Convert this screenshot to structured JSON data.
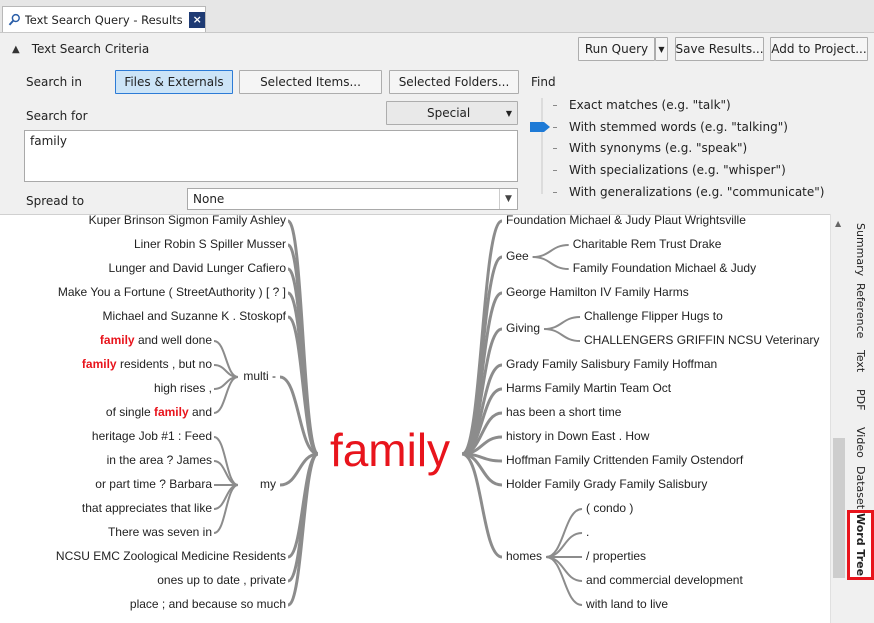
{
  "tab": {
    "title": "Text Search Query - Results Pre",
    "close": "×"
  },
  "criteria": {
    "header": "Text Search Criteria",
    "buttons": {
      "run": "Run Query",
      "save": "Save Results...",
      "add": "Add to Project..."
    },
    "search_in_label": "Search in",
    "search_in_options": [
      "Files & Externals",
      "Selected Items...",
      "Selected Folders..."
    ],
    "search_in_selected": "Files & Externals",
    "search_for_label": "Search for",
    "special_label": "Special",
    "search_value": "family",
    "spread_label": "Spread to",
    "spread_value": "None",
    "find_label": "Find",
    "find_options": [
      "Exact matches (e.g. \"talk\")",
      "With stemmed words (e.g. \"talking\")",
      "With synonyms (e.g. \"speak\")",
      "With specializations (e.g. \"whisper\")",
      "With generalizations (e.g. \"communicate\")"
    ],
    "find_selected_index": 1
  },
  "word_tree": {
    "root": "family",
    "highlight_color": "#e8141c",
    "left": [
      {
        "segments": [
          {
            "t": "Kuper Brinson Sigmon Family Ashley"
          }
        ]
      },
      {
        "segments": [
          {
            "t": "Liner Robin S Spiller Musser"
          }
        ]
      },
      {
        "segments": [
          {
            "t": "Lunger and David Lunger Cafiero"
          }
        ]
      },
      {
        "segments": [
          {
            "t": "Make You a Fortune ( StreetAuthority ) [ ? ]"
          }
        ]
      },
      {
        "segments": [
          {
            "t": "Michael and Suzanne K . Stoskopf"
          }
        ]
      },
      {
        "group": "multi -",
        "children": [
          {
            "segments": [
              {
                "t": "family",
                "hl": true
              },
              {
                "t": " and well done"
              }
            ]
          },
          {
            "segments": [
              {
                "t": "family",
                "hl": true
              },
              {
                "t": " residents , but no"
              }
            ]
          },
          {
            "segments": [
              {
                "t": "high rises ,"
              }
            ]
          },
          {
            "segments": [
              {
                "t": "of single "
              },
              {
                "t": "family",
                "hl": true
              },
              {
                "t": " and"
              }
            ]
          }
        ]
      },
      {
        "group": "my",
        "children": [
          {
            "segments": [
              {
                "t": "heritage Job #1 : Feed"
              }
            ]
          },
          {
            "segments": [
              {
                "t": "in the area ? James"
              }
            ]
          },
          {
            "segments": [
              {
                "t": "or part time ? Barbara"
              }
            ]
          },
          {
            "segments": [
              {
                "t": "that appreciates that like"
              }
            ]
          },
          {
            "segments": [
              {
                "t": "There was seven in"
              }
            ]
          }
        ]
      },
      {
        "segments": [
          {
            "t": "NCSU EMC Zoological Medicine Residents"
          }
        ]
      },
      {
        "segments": [
          {
            "t": "ones up to date , private"
          }
        ]
      },
      {
        "segments": [
          {
            "t": "place ; and because so much"
          }
        ]
      }
    ],
    "right": [
      {
        "segments": [
          {
            "t": "Foundation Michael & Judy Plaut Wrightsville"
          }
        ]
      },
      {
        "group": "Gee",
        "children": [
          {
            "segments": [
              {
                "t": "Charitable Rem Trust Drake"
              }
            ]
          },
          {
            "segments": [
              {
                "t": "Family Foundation Michael & Judy"
              }
            ]
          }
        ]
      },
      {
        "segments": [
          {
            "t": "George Hamilton IV Family Harms"
          }
        ]
      },
      {
        "group": "Giving",
        "children": [
          {
            "segments": [
              {
                "t": "Challenge Flipper Hugs to"
              }
            ]
          },
          {
            "segments": [
              {
                "t": "CHALLENGERS GRIFFIN NCSU Veterinary"
              }
            ]
          }
        ]
      },
      {
        "segments": [
          {
            "t": "Grady Family Salisbury Family Hoffman"
          }
        ]
      },
      {
        "segments": [
          {
            "t": "Harms Family Martin Team Oct"
          }
        ]
      },
      {
        "segments": [
          {
            "t": "has been a short time"
          }
        ]
      },
      {
        "segments": [
          {
            "t": "history in Down East . How"
          }
        ]
      },
      {
        "segments": [
          {
            "t": "Hoffman Family Crittenden Family Ostendorf"
          }
        ]
      },
      {
        "segments": [
          {
            "t": "Holder Family Grady Family Salisbury"
          }
        ]
      },
      {
        "group": "homes",
        "children": [
          {
            "segments": [
              {
                "t": "( condo )"
              }
            ]
          },
          {
            "segments": [
              {
                "t": "."
              }
            ]
          },
          {
            "segments": [
              {
                "t": "/ properties"
              }
            ]
          },
          {
            "segments": [
              {
                "t": "and commercial development"
              }
            ]
          },
          {
            "segments": [
              {
                "t": "with land to live"
              }
            ]
          }
        ]
      }
    ]
  },
  "side_tabs": [
    {
      "label": "Summary"
    },
    {
      "label": "Reference"
    },
    {
      "label": "Text"
    },
    {
      "label": "PDF"
    },
    {
      "label": "Video"
    },
    {
      "label": "Dataset"
    },
    {
      "label": "Word Tree",
      "active": true
    }
  ]
}
